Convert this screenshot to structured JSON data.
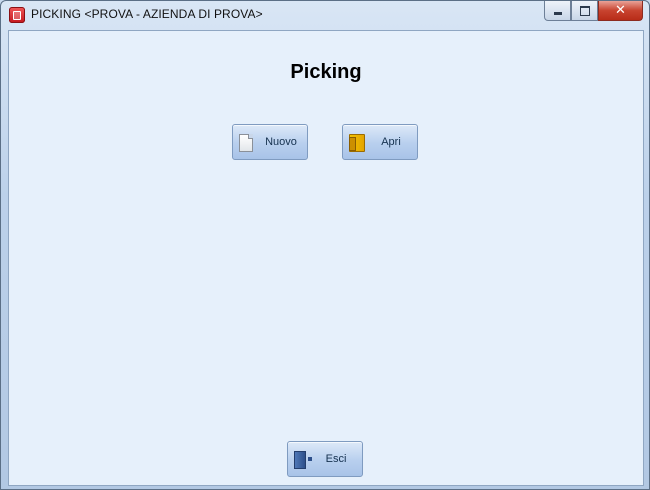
{
  "window": {
    "title": "PICKING <PROVA - AZIENDA DI PROVA>",
    "controls": {
      "minimize": "minimize",
      "maximize": "maximize",
      "close": "close"
    }
  },
  "main": {
    "heading": "Picking",
    "buttons": {
      "new": {
        "label": "Nuovo",
        "icon": "new-document-icon"
      },
      "open": {
        "label": "Apri",
        "icon": "folder-icon"
      },
      "exit": {
        "label": "Esci",
        "icon": "exit-door-icon"
      }
    }
  }
}
